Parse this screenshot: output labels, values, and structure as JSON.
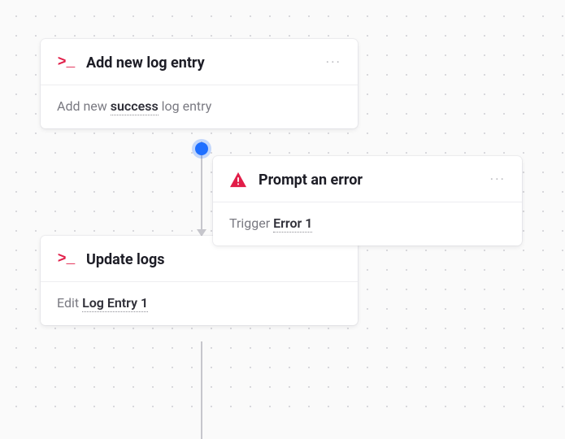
{
  "nodes": {
    "a": {
      "title": "Add new log entry",
      "body_pre": "Add new ",
      "body_em": "success",
      "body_post": " log entry"
    },
    "b": {
      "title": "Prompt an error",
      "body_pre": "Trigger ",
      "body_em": "Error 1",
      "body_post": ""
    },
    "c": {
      "title": "Update logs",
      "body_pre": "Edit ",
      "body_em": "Log Entry 1",
      "body_post": ""
    }
  },
  "menu_glyph": "···"
}
